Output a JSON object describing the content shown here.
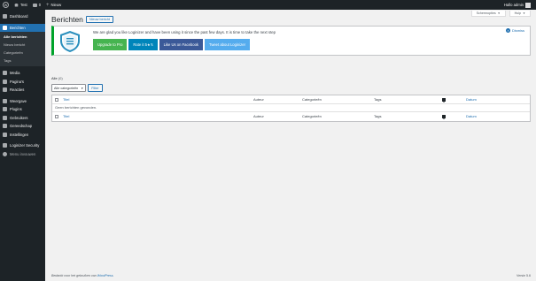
{
  "adminbar": {
    "site_name": "Test",
    "comments_count": "0",
    "new_label": "Nieuw",
    "greeting": "Hallo admin"
  },
  "sidebar": {
    "items": [
      {
        "label": "Dashboard",
        "icon": "dashboard-icon"
      },
      {
        "label": "Berichten",
        "icon": "pin-icon",
        "active": true
      },
      {
        "label": "Media",
        "icon": "media-icon"
      },
      {
        "label": "Pagina's",
        "icon": "page-icon"
      },
      {
        "label": "Reacties",
        "icon": "comments-icon"
      },
      {
        "label": "Weergave",
        "icon": "appearance-icon"
      },
      {
        "label": "Plugins",
        "icon": "plugin-icon"
      },
      {
        "label": "Gebruikers",
        "icon": "users-icon"
      },
      {
        "label": "Gereedschap",
        "icon": "tools-icon"
      },
      {
        "label": "Instellingen",
        "icon": "settings-icon"
      },
      {
        "label": "Loginizer Security",
        "icon": "shield-icon"
      }
    ],
    "submenu": [
      "Alle berichten",
      "Nieuw bericht",
      "Categorieën",
      "Tags"
    ],
    "collapse_label": "Menu invouwen"
  },
  "screen_tabs": {
    "options": "Schermopties",
    "help": "Hulp"
  },
  "page": {
    "title": "Berichten",
    "add_new": "Nieuw bericht"
  },
  "notice": {
    "text": "We are glad you like Loginizer and have been using it since the past few days. It is time to take the next step",
    "buttons": [
      {
        "label": "Upgrade to Pro",
        "color": "#46b450"
      },
      {
        "label": "Rate it 5★'s",
        "color": "#0085ba"
      },
      {
        "label": "Like Us on Facebook",
        "color": "#3b5998"
      },
      {
        "label": "Tweet about Loginizer",
        "color": "#55acee"
      }
    ],
    "dismiss": "Dismiss"
  },
  "filters": {
    "all_label": "Alle",
    "all_count": "(0)",
    "category_select": "Alle categorieën",
    "filter_button": "Filter"
  },
  "table": {
    "columns": {
      "title": "Titel",
      "author": "Auteur",
      "categories": "Categorieën",
      "tags": "Tags",
      "date": "Datum"
    },
    "empty_message": "Geen berichten gevonden."
  },
  "footer": {
    "thanks_prefix": "Bedankt voor het gebruiken van ",
    "thanks_link": "WordPress",
    "thanks_suffix": ".",
    "version": "Versie 5.6"
  },
  "colors": {
    "accent": "#2271b1",
    "sidebar": "#1d2327",
    "notice_border": "#00a32a"
  }
}
